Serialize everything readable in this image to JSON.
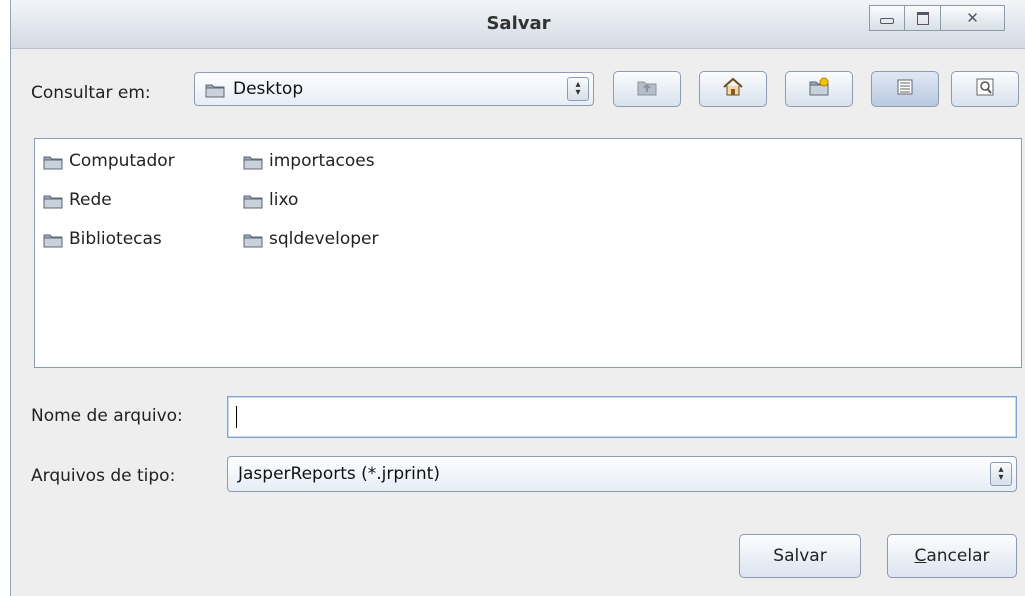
{
  "window": {
    "title": "Salvar"
  },
  "lookin": {
    "label": "Consultar em:",
    "value": "Desktop"
  },
  "toolbar": {
    "buttons": [
      "up-folder-icon",
      "home-icon",
      "new-folder-icon",
      "list-view-icon",
      "details-view-icon"
    ]
  },
  "files": {
    "col1": [
      "Computador",
      "Rede",
      "Bibliotecas"
    ],
    "col2": [
      "importacoes",
      "lixo",
      "sqldeveloper"
    ]
  },
  "filename": {
    "label": "Nome de arquivo:",
    "value": ""
  },
  "filetype": {
    "label": "Arquivos de tipo:",
    "value": "JasperReports (*.jrprint)"
  },
  "buttons": {
    "save": "Salvar",
    "cancel_mnemonic": "C",
    "cancel_rest": "ancelar"
  }
}
